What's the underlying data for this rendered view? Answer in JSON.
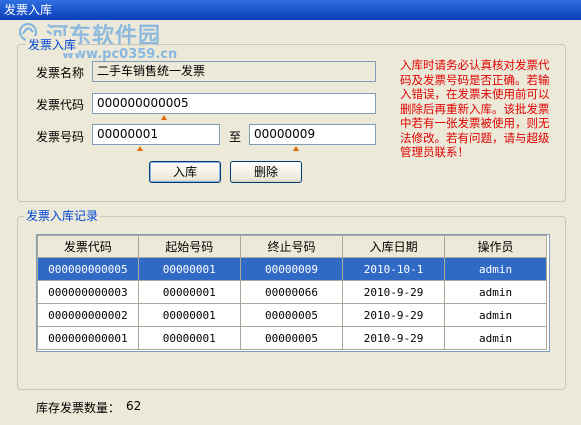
{
  "window": {
    "title": "发票入库"
  },
  "watermark": {
    "site_name": "河东软件园",
    "url": "www.pc0359.cn"
  },
  "entry_group": {
    "legend": "发票入库",
    "invoice_name_label": "发票名称",
    "invoice_name_value": "二手车销售统一发票",
    "invoice_code_label": "发票代码",
    "invoice_code_value": "000000000005",
    "invoice_number_label": "发票号码",
    "start_number_value": "00000001",
    "to_label": "至",
    "end_number_value": "00000009",
    "stock_in_button": "入库",
    "delete_button": "删除",
    "notice": "入库时请务必认真核对发票代码及发票号码是否正确。若输入错误，在发票未使用前可以删除后再重新入库。该批发票中若有一张发票被使用，则无法修改。若有问题，请与超级管理员联系！"
  },
  "records_group": {
    "legend": "发票入库记录",
    "columns": [
      "发票代码",
      "起始号码",
      "终止号码",
      "入库日期",
      "操作员"
    ],
    "rows": [
      [
        "000000000005",
        "00000001",
        "00000009",
        "2010-10-1",
        "admin"
      ],
      [
        "000000000003",
        "00000001",
        "00000066",
        "2010-9-29",
        "admin"
      ],
      [
        "000000000002",
        "00000001",
        "00000005",
        "2010-9-29",
        "admin"
      ],
      [
        "000000000001",
        "00000001",
        "00000005",
        "2010-9-29",
        "admin"
      ]
    ],
    "selected_row": 0
  },
  "footer": {
    "stock_count_label": "库存发票数量：",
    "stock_count_value": "62"
  },
  "colors": {
    "accent": "#0046d5",
    "notice": "#e00000",
    "selection": "#316ac5",
    "marker": "#e06c00"
  }
}
